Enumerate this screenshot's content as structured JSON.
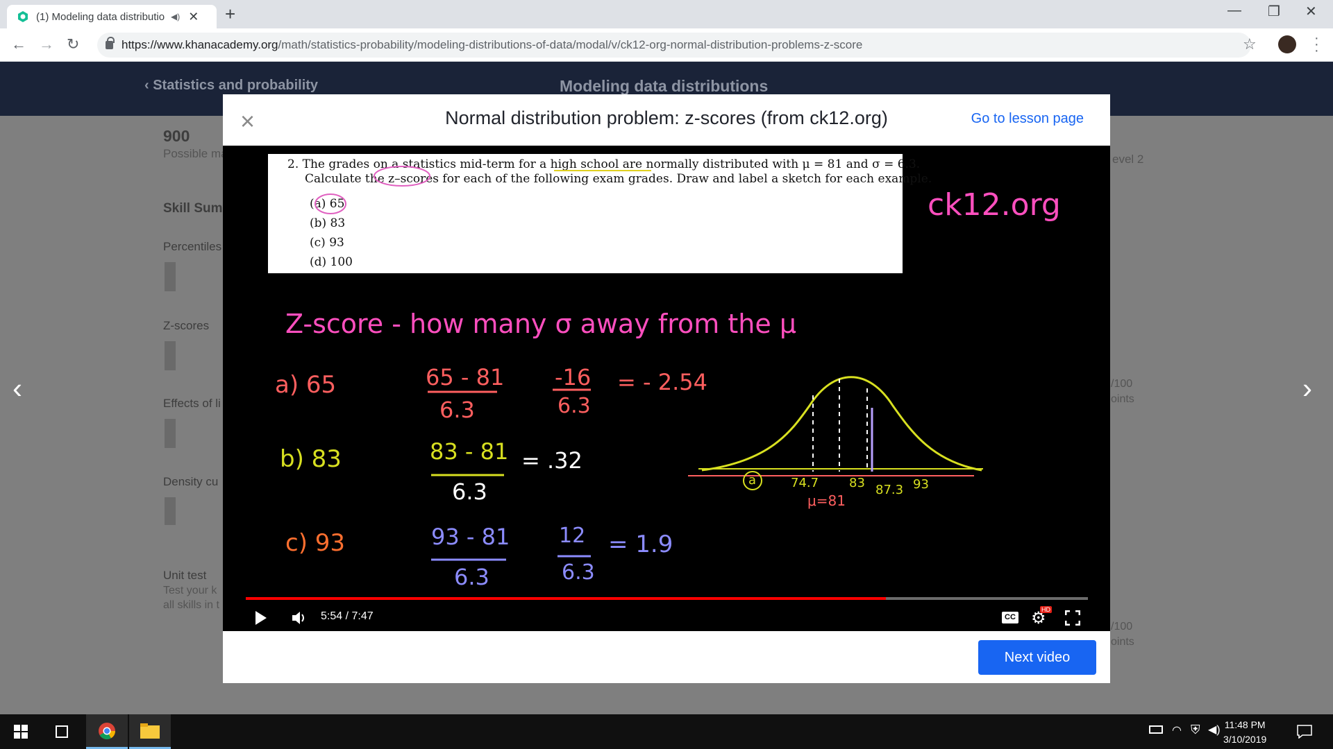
{
  "browser": {
    "tab_title": "(1) Modeling data distributio",
    "url_domain": "https://www.khanacademy.org",
    "url_path": "/math/statistics-probability/modeling-distributions-of-data/modal/v/ck12-org-normal-distribution-problems-z-score"
  },
  "background_page": {
    "breadcrumb": "Statistics and probability",
    "unit_title": "Modeling data distributions",
    "points": "900",
    "points_caption": "Possible ma",
    "skill_summary": "Skill Summ",
    "skills": [
      "Percentiles",
      "Z-scores",
      "Effects of li",
      "Density cu"
    ],
    "unit_test": "Unit test",
    "unit_test_desc1": "Test your k",
    "unit_test_desc2": "all skills in t",
    "level_label": "evel 2",
    "pts1": "/100",
    "pts1b": "oints",
    "pts2": "/100",
    "pts2b": "oints"
  },
  "modal": {
    "title": "Normal distribution problem: z-scores (from ck12.org)",
    "lesson_link": "Go to lesson page",
    "next_button": "Next video"
  },
  "video": {
    "problem_line1": "2.  The grades on a statistics mid-term for a high school are normally distributed with μ = 81 and σ = 6.3.",
    "problem_line2": "Calculate the z–scores for each of the following exam grades.  Draw and label a sketch for each example.",
    "options": [
      "(a)  65",
      "(b)  83",
      "(c)  93",
      "(d)  100"
    ],
    "watermark": "ck12.org",
    "heading": "Z-score - how many σ away from the μ",
    "rows": [
      {
        "label": "a)  65",
        "num": "65 - 81",
        "den": "6.3",
        "num2": "-16",
        "den2": "6.3",
        "result": "= - 2.54"
      },
      {
        "label": "b)  83",
        "num": "83 - 81",
        "den": "6.3",
        "result": "= .32"
      },
      {
        "label": "c)  93",
        "num": "93 - 81",
        "den": "6.3",
        "num2": "12",
        "den2": "6.3",
        "result": "= 1.9"
      }
    ],
    "sketch_labels": {
      "a": "a",
      "l1": "74.7",
      "l2": "83",
      "l3": "87.3",
      "l4": "93",
      "mu": "μ=81"
    },
    "time": "5:54 / 7:47",
    "progress": 0.76,
    "cc": "CC",
    "hd": "HD"
  },
  "taskbar": {
    "time": "11:48 PM",
    "date": "3/10/2019"
  }
}
